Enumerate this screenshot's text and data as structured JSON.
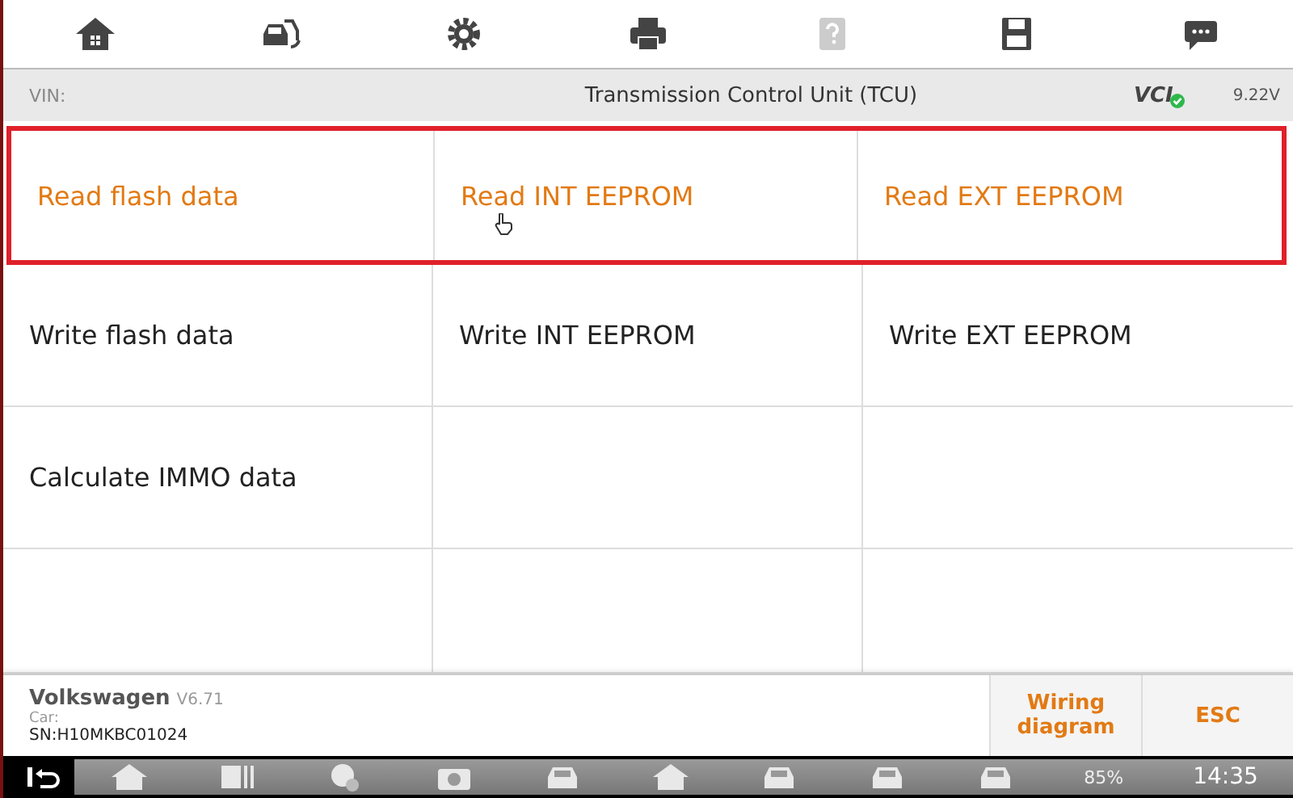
{
  "toolbar": {
    "items": [
      {
        "kind": "home",
        "disabled": false
      },
      {
        "kind": "vehicle",
        "disabled": false
      },
      {
        "kind": "settings",
        "disabled": false
      },
      {
        "kind": "print",
        "disabled": false
      },
      {
        "kind": "help",
        "disabled": true
      },
      {
        "kind": "save",
        "disabled": false
      },
      {
        "kind": "message",
        "disabled": false
      }
    ]
  },
  "header": {
    "vin_label": "VIN:",
    "title": "Transmission Control Unit (TCU)",
    "vci": "VCI",
    "voltage": "9.22V"
  },
  "grid": {
    "rows": [
      {
        "highlighted": true,
        "cells": [
          "Read flash data",
          "Read INT EEPROM",
          "Read EXT EEPROM"
        ]
      },
      {
        "highlighted": false,
        "cells": [
          "Write flash data",
          "Write INT EEPROM",
          "Write EXT EEPROM"
        ]
      },
      {
        "highlighted": false,
        "cells": [
          "Calculate IMMO data"
        ]
      }
    ]
  },
  "footer": {
    "make": "Volkswagen",
    "version": "V6.71",
    "car_label": "Car:",
    "serial": "SN:H10MKBC01024",
    "buttons": [
      "Wiring diagram",
      "ESC"
    ]
  },
  "taskbar": {
    "battery": "85%",
    "time": "14:35"
  }
}
